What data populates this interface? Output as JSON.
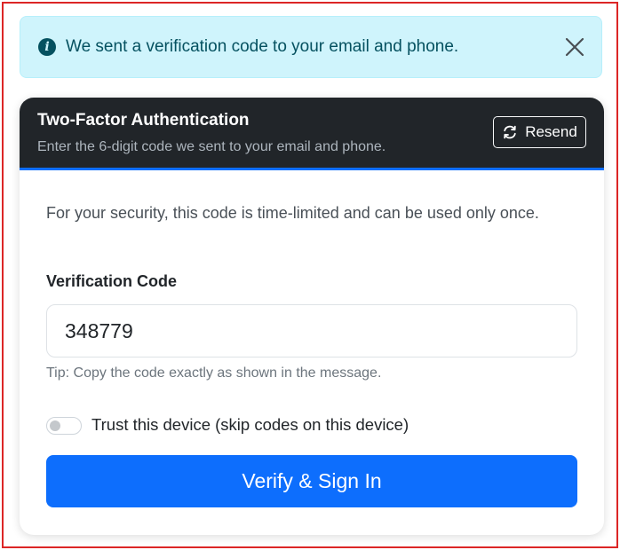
{
  "alert": {
    "icon": "info-icon",
    "message": "We sent a verification code to your email and phone.",
    "close_icon": "close-icon"
  },
  "card": {
    "title": "Two-Factor Authentication",
    "subtitle": "Enter the 6-digit code we sent to your email and phone.",
    "resend_label": "Resend",
    "resend_icon": "refresh-icon",
    "notice": "For your security, this code is time-limited and can be used only once.",
    "code_label": "Verification Code",
    "code_value": "348779",
    "tip": "Tip: Copy the code exactly as shown in the message.",
    "trust_device_label": "Trust this device (skip codes on this device)",
    "trust_device_checked": false,
    "verify_label": "Verify & Sign In"
  },
  "colors": {
    "alert_bg": "#cff4fc",
    "alert_text": "#055160",
    "header_bg": "#212529",
    "accent": "#0d6efd",
    "frame_border": "#dc2626"
  }
}
